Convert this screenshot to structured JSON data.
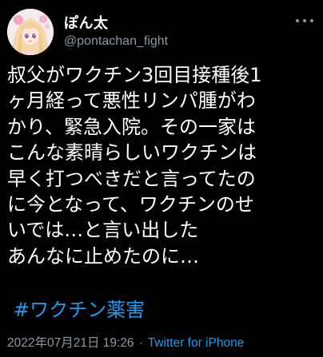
{
  "tweet": {
    "display_name": "ぽん太",
    "handle": "@pontachan_fight",
    "body_lines": [
      "叔父がワクチン3回目接種後1",
      "ヶ月経って悪性リンパ腫がわ",
      "かり、緊急入院。その一家は",
      "こんな素晴らしいワクチンは",
      "早く打つべきだと言ってたの",
      "に今となって、ワクチンのせ",
      "いでは…と言い出した",
      "あんなに止めたのに…"
    ],
    "hashtag": "#ワクチン薬害",
    "timestamp": "2022年07月21日 19:26",
    "separator": "·",
    "source": "Twitter for iPhone"
  },
  "icons": {
    "avatar": "anime-girl-avatar",
    "more": "more-horizontal-icon"
  },
  "colors": {
    "background": "#000000",
    "text": "#ffffff",
    "secondary": "#8b98a5",
    "accent": "#1d9bf0"
  }
}
